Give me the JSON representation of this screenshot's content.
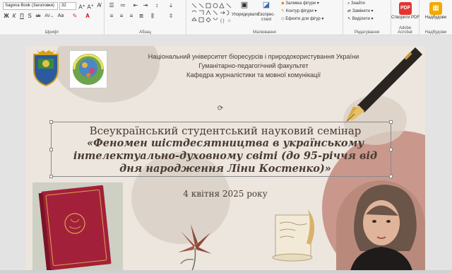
{
  "ribbon": {
    "font_name": "Sagona Book (Заголовки)",
    "font_size": "32",
    "groups": {
      "font": "Шрифт",
      "paragraph": "Абзац",
      "drawing": "Малювання",
      "editing": "Редагування",
      "acrobat": "Adobe Acrobat",
      "addins": "Надбудови"
    },
    "format_buttons": [
      "Ж",
      "К",
      "П",
      "S",
      "ab"
    ],
    "arrange_label": "Упорядкувати",
    "express_styles_label": "Експрес-стилі",
    "shape_fill_label": "Заливка фігури",
    "shape_outline_label": "Контур фігури",
    "shape_effects_label": "Ефекти для фігур",
    "find_label": "Знайти",
    "replace_label": "Замінити",
    "select_label": "Виділити",
    "create_pdf_label": "Створити PDF",
    "addins_label": "Надбудови"
  },
  "slide": {
    "header_line1": "Національний університет біоресурсів і природокористування України",
    "header_line2": "Гуманітарно-педагогічний факультет",
    "header_line3": "Кафедра журналістики та мовної комунікації",
    "title_regular": "Всеукраїнський студентський науковий семінар",
    "title_italic_1": "«Феномен шістдесятництва в українському",
    "title_italic_2": "інтелектуально-духовному світі (до 95-річчя від",
    "title_italic_3": "дня народження Ліни Костенко)»",
    "date": "4 квітня 2025 року"
  },
  "colors": {
    "accent_brown": "#4a3b30",
    "blob_rose": "#c9978c",
    "blob_grey": "#cfc6bb",
    "book_red": "#a3203a"
  }
}
